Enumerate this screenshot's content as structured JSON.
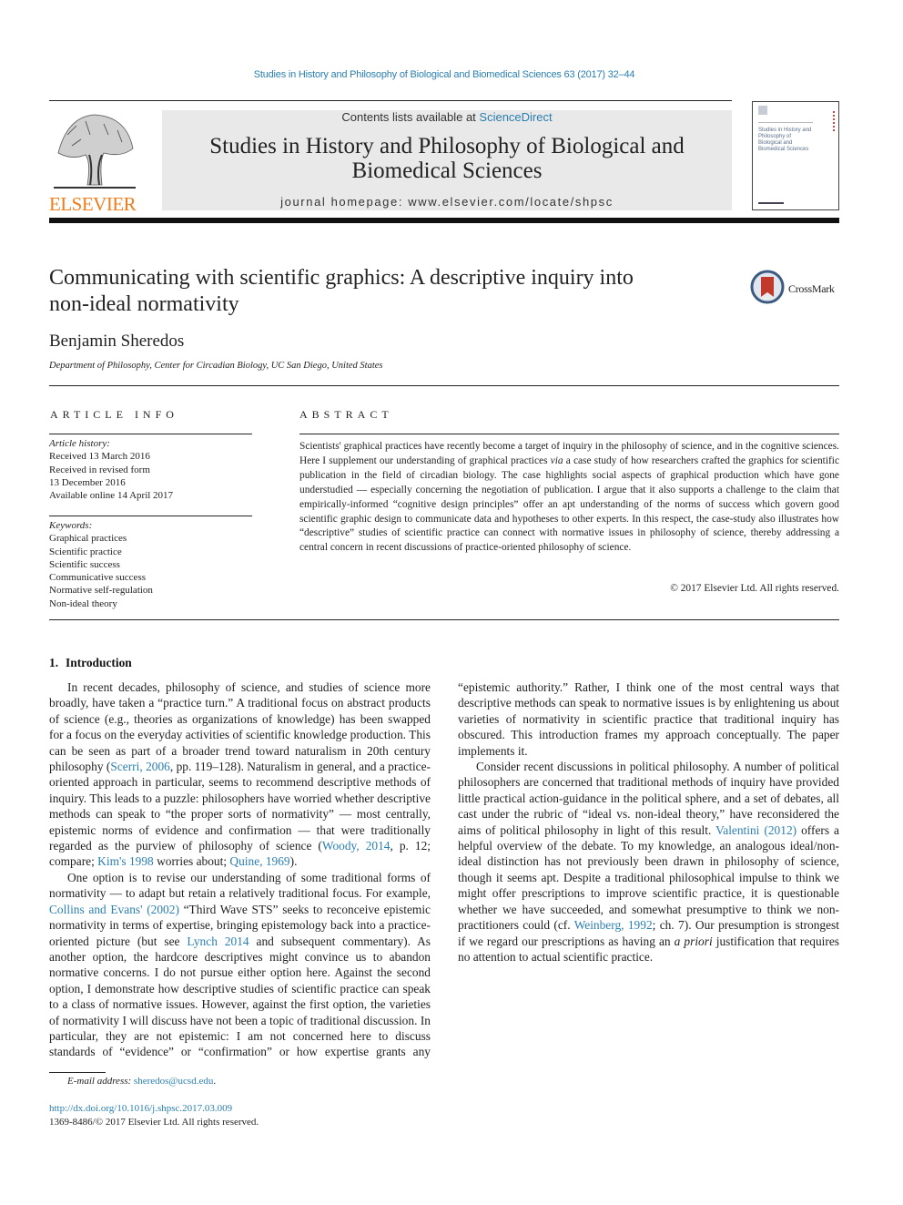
{
  "header": {
    "citation": "Studies in History and Philosophy of Biological and Biomedical Sciences 63 (2017) 32–44",
    "contents_prefix": "Contents lists available at ",
    "contents_link": "ScienceDirect",
    "journal_title_line1": "Studies in History and Philosophy of Biological and",
    "journal_title_line2": "Biomedical Sciences",
    "homepage": "journal homepage: www.elsevier.com/locate/shpsc",
    "publisher_logo_text": "ELSEVIER",
    "cover_title": "Studies in History and Philosophy of Biological and Biomedical Sciences"
  },
  "article": {
    "title_line1": "Communicating with scientific graphics: A descriptive inquiry into",
    "title_line2": "non-ideal normativity",
    "crossmark_label": "CrossMark",
    "author": "Benjamin Sheredos",
    "affiliation": "Department of Philosophy, Center for Circadian Biology, UC San Diego, United States"
  },
  "article_info": {
    "heading": "ARTICLE INFO",
    "history_label": "Article history:",
    "history": [
      "Received 13 March 2016",
      "Received in revised form",
      "13 December 2016",
      "Available online 14 April 2017"
    ],
    "keywords_label": "Keywords:",
    "keywords": [
      "Graphical practices",
      "Scientific practice",
      "Scientific success",
      "Communicative success",
      "Normative self-regulation",
      "Non-ideal theory"
    ]
  },
  "abstract": {
    "heading": "ABSTRACT",
    "part1": "Scientists' graphical practices have recently become a target of inquiry in the philosophy of science, and in the cognitive sciences. Here I supplement our understanding of graphical practices ",
    "via": "via",
    "part2": " a case study of how researchers crafted the graphics for scientific publication in the field of circadian biology. The case highlights social aspects of graphical production which have gone understudied — especially concerning the negotiation of publication. I argue that it also supports a challenge to the claim that empirically-informed “cognitive design principles” offer an apt understanding of the norms of success which govern good scientific graphic design to communicate data and hypotheses to other experts. In this respect, the case-study also illustrates how “descriptive” studies of scientific practice can connect with normative issues in philosophy of science, thereby addressing a central concern in recent discussions of practice-oriented philosophy of science.",
    "copyright": "© 2017 Elsevier Ltd. All rights reserved."
  },
  "body": {
    "section_number": "1.",
    "section_title": "Introduction",
    "p1": {
      "t1": "In recent decades, philosophy of science, and studies of science more broadly, have taken a “practice turn.” A traditional focus on abstract products of science (e.g., theories as organizations of knowledge) has been swapped for a focus on the everyday activities of scientific knowledge production. This can be seen as part of a broader trend toward naturalism in 20th century philosophy (",
      "l1": "Scerri, 2006",
      "t2": ", pp. 119–128). Naturalism in general, and a practice-oriented approach in particular, seems to recommend descriptive methods of inquiry. This leads to a puzzle: philosophers have worried whether descriptive methods can speak to “the proper sorts of normativity” — most centrally, epistemic norms of evidence and confirmation — that were traditionally regarded as the purview of philosophy of science (",
      "l2": "Woody, 2014",
      "t3": ", p. 12; compare; ",
      "l3": "Kim's 1998",
      "t4": " worries about; ",
      "l4": "Quine, 1969",
      "t5": ")."
    },
    "p2": {
      "t1": "One option is to revise our understanding of some traditional forms of normativity — to adapt but retain a relatively traditional focus. For example, ",
      "l1": "Collins and Evans' (2002)",
      "t2": " “Third Wave STS” seeks to reconceive epistemic normativity in terms of expertise, bringing epistemology back into a practice-oriented picture (but see ",
      "l2": "Lynch 2014",
      "t3": " and subsequent commentary). As another option, the hardcore descriptives might convince us to abandon normative concerns. I do not pursue either option here. Against the second option, I demonstrate how descriptive studies of scientific practice can speak to a class of normative issues. However, against the first option, the varieties of normativity I will discuss have not been a topic of traditional discussion. In particular, they are not epistemic: I am not concerned here to discuss standards of “evidence” or “confirmation” or how expertise grants any “epistemic authority.” Rather, I think one of the most central ways that descriptive methods can speak to normative issues is by enlightening us about varieties of normativity in scientific practice that traditional inquiry has obscured. This introduction frames my approach conceptually. The paper implements it."
    },
    "p3": {
      "t1": "Consider recent discussions in political philosophy. A number of political philosophers are concerned that traditional methods of inquiry have provided little practical action-guidance in the political sphere, and a set of debates, all cast under the rubric of “ideal vs. non-ideal theory,” have reconsidered the aims of political philosophy in light of this result. ",
      "l1": "Valentini (2012)",
      "t2": " offers a helpful overview of the debate. To my knowledge, an analogous ideal/non-ideal distinction has not previously been drawn in philosophy of science, though it seems apt. Despite a traditional philosophical impulse to think we might offer prescriptions to improve scientific practice, it is questionable whether we have succeeded, and somewhat presumptive to think we non-practitioners could (cf. ",
      "l2": "Weinberg, 1992",
      "t3": "; ch. 7). Our presumption is strongest if we regard our prescriptions as having an ",
      "em": "a priori",
      "t4": " justification that requires no attention to actual scientific practice."
    }
  },
  "footer": {
    "email_label": "E-mail address:",
    "email": "sheredos@ucsd.edu",
    "email_suffix": ".",
    "doi": "http://dx.doi.org/10.1016/j.shpsc.2017.03.009",
    "issn_line": "1369-8486/© 2017 Elsevier Ltd. All rights reserved."
  },
  "colors": {
    "link": "#2a7fb0",
    "elsevier_orange": "#f07d1a",
    "masthead_gray": "#e9e9e9",
    "crossmark_red": "#c0392b"
  }
}
